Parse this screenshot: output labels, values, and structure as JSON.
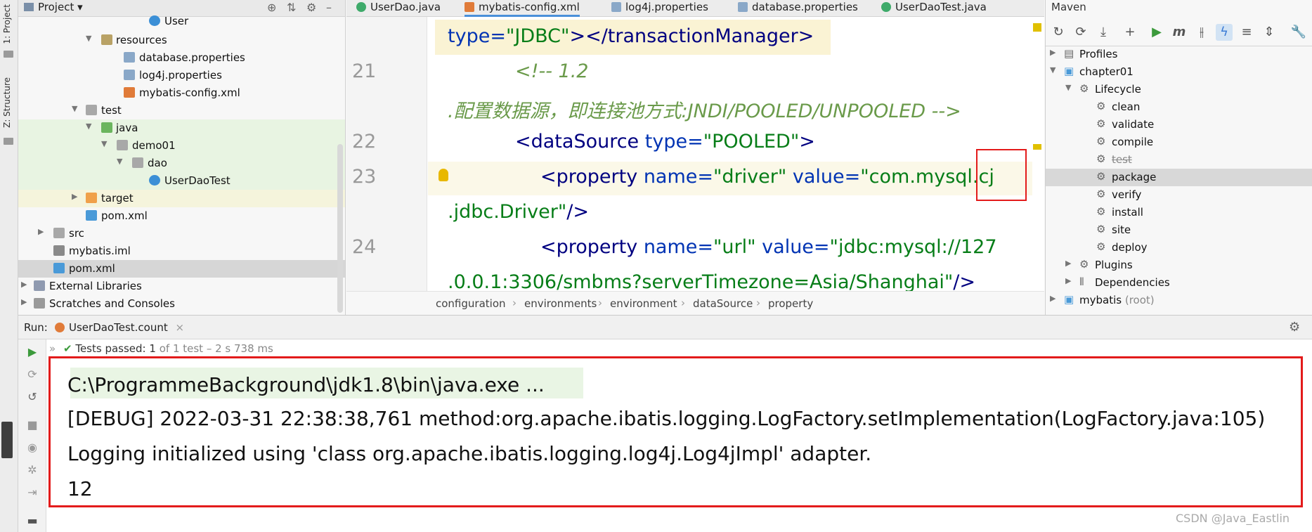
{
  "left_strip": {
    "project_tab": "1: Project",
    "structure_tab": "Z: Structure"
  },
  "project_panel": {
    "title": "Project",
    "tree": [
      {
        "label": "User",
        "icon": "class-icon"
      },
      {
        "label": "resources",
        "icon": "resources-folder-icon"
      },
      {
        "label": "database.properties",
        "icon": "properties-file-icon"
      },
      {
        "label": "log4j.properties",
        "icon": "properties-file-icon"
      },
      {
        "label": "mybatis-config.xml",
        "icon": "xml-file-icon"
      },
      {
        "label": "test",
        "icon": "folder-icon"
      },
      {
        "label": "java",
        "icon": "test-source-folder-icon"
      },
      {
        "label": "demo01",
        "icon": "package-icon"
      },
      {
        "label": "dao",
        "icon": "package-icon"
      },
      {
        "label": "UserDaoTest",
        "icon": "class-icon"
      },
      {
        "label": "target",
        "icon": "excluded-folder-icon"
      },
      {
        "label": "pom.xml",
        "icon": "maven-file-icon"
      },
      {
        "label": "src",
        "icon": "folder-icon"
      },
      {
        "label": "mybatis.iml",
        "icon": "iml-file-icon"
      },
      {
        "label": "pom.xml",
        "icon": "maven-file-icon"
      },
      {
        "label": "External Libraries",
        "icon": "libraries-icon"
      },
      {
        "label": "Scratches and Consoles",
        "icon": "scratches-icon"
      }
    ]
  },
  "editor": {
    "tabs": [
      "UserDao.java",
      "mybatis-config.xml",
      "log4j.properties",
      "database.properties",
      "UserDaoTest.java"
    ],
    "active_tab": "mybatis-config.xml",
    "line_numbers": [
      "21",
      "22",
      "23",
      "24"
    ],
    "code": {
      "l0_attr": "type=",
      "l0_val": "\"JDBC\"",
      "l0_tag": "></transactionManager>",
      "l21_comment": "<!-- 1.2",
      "l21b_comment": ".配置数据源，即连接池方式:JNDI/POOLED/UNPOOLED -->",
      "l22_tag": "<dataSource",
      "l22_attr": "type=",
      "l22_val": "\"POOLED\"",
      "l22_end": ">",
      "l23_tag": "<property",
      "l23_attr1": "name=",
      "l23_val1": "\"driver\"",
      "l23_attr2": "value=",
      "l23_val2": "\"com.mysql.cj",
      "l23b_val": ".jdbc.Driver\"",
      "l23b_end": "/>",
      "l24_tag": "<property",
      "l24_attr1": "name=",
      "l24_val1": "\"url\"",
      "l24_attr2": "value=",
      "l24_val2": "\"jdbc:mysql://127",
      "l24b_val": ".0.0.1:3306/smbms?serverTimezone=Asia/Shanghai\"",
      "l24b_end": "/>"
    },
    "breadcrumb": [
      "configuration",
      "environments",
      "environment",
      "dataSource",
      "property"
    ]
  },
  "maven": {
    "title": "Maven",
    "tree": {
      "profiles": "Profiles",
      "project": "chapter01",
      "lifecycle": "Lifecycle",
      "phases": [
        "clean",
        "validate",
        "compile",
        "test",
        "package",
        "verify",
        "install",
        "site",
        "deploy"
      ],
      "plugins": "Plugins",
      "dependencies": "Dependencies",
      "root_project": "mybatis",
      "root_suffix": "(root)"
    }
  },
  "run": {
    "label": "Run:",
    "tab": "UserDaoTest.count",
    "tests_passed": "Tests passed:",
    "tests_count": "1",
    "tests_detail": "of 1 test – 2 s 738 ms",
    "console_lines": [
      "C:\\ProgrammeBackground\\jdk1.8\\bin\\java.exe ...",
      "[DEBUG] 2022-03-31 22:38:38,761 method:org.apache.ibatis.logging.LogFactory.setImplementation(LogFactory.java:105)",
      "Logging initialized using 'class org.apache.ibatis.logging.log4j.Log4jImpl' adapter.",
      "12"
    ]
  },
  "watermark": "CSDN @Java_Eastlin",
  "colors": {
    "highlight_red": "#e31b1b",
    "xml_tag": "#000080",
    "xml_attr": "#0033b3",
    "xml_value": "#067d17",
    "comment": "#6a9a4a",
    "run_green": "#3c9a3c"
  }
}
